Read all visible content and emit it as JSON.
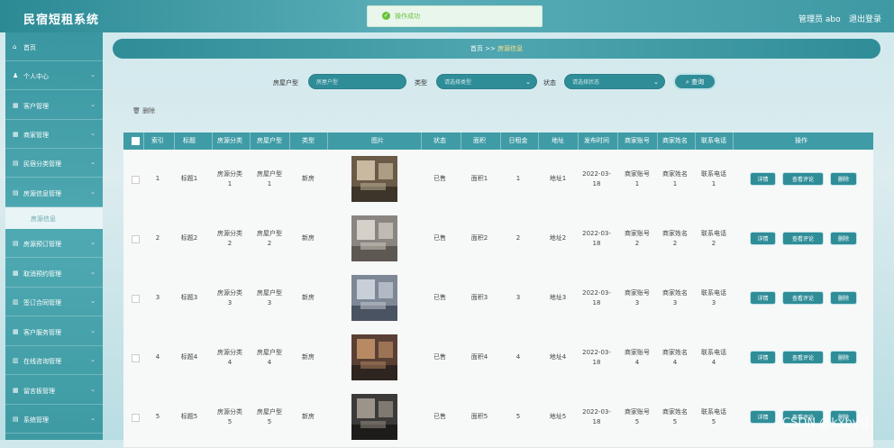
{
  "header": {
    "brand": "民宿短租系统",
    "toast": "操作成功",
    "user": "管理员 abo",
    "logout": "退出登录"
  },
  "sidebar": {
    "items": [
      {
        "icon": "⌂",
        "label": "首页"
      },
      {
        "icon": "♟",
        "label": "个人中心"
      },
      {
        "icon": "▦",
        "label": "客户管理"
      },
      {
        "icon": "▦",
        "label": "商家管理"
      },
      {
        "icon": "▤",
        "label": "民宿分类管理"
      },
      {
        "icon": "▤",
        "label": "房源信息管理"
      },
      {
        "icon": "▤",
        "label": "房源预订管理"
      },
      {
        "icon": "▦",
        "label": "取消预约管理"
      },
      {
        "icon": "▥",
        "label": "签订合同管理"
      },
      {
        "icon": "▦",
        "label": "客户服务管理"
      },
      {
        "icon": "▥",
        "label": "在线咨询管理"
      },
      {
        "icon": "▦",
        "label": "留言板管理"
      },
      {
        "icon": "▤",
        "label": "系统管理"
      }
    ],
    "sub_item": "房源信息"
  },
  "breadcrumb": {
    "home": "首页",
    "sep": ">>",
    "current": "房源信息"
  },
  "search": {
    "type_label": "房屋户型",
    "type_placeholder": "房屋户型",
    "kind_label": "类型",
    "kind_placeholder": "请选择类型",
    "status_label": "状态",
    "status_placeholder": "请选择状态",
    "button": "查询"
  },
  "delete_label": "删除",
  "table": {
    "headers": [
      "索引",
      "标题",
      "房源分类",
      "房屋户型",
      "类型",
      "图片",
      "状态",
      "面积",
      "日租金",
      "地址",
      "发布时间",
      "商家账号",
      "商家姓名",
      "联系电话",
      "操作"
    ],
    "rows": [
      {
        "idx": "1",
        "title": "标题1",
        "cat": [
          "房源分类",
          "1"
        ],
        "layout": [
          "房屋户型",
          "1"
        ],
        "kind": "新房",
        "status": "已售",
        "area": "面积1",
        "rent": "1",
        "addr": "地址1",
        "date": [
          "2022-03-",
          "18"
        ],
        "acct": [
          "商家账号",
          "1"
        ],
        "name": [
          "商家姓名",
          "1"
        ],
        "phone": [
          "联系电话",
          "1"
        ]
      },
      {
        "idx": "2",
        "title": "标题2",
        "cat": [
          "房源分类",
          "2"
        ],
        "layout": [
          "房屋户型",
          "2"
        ],
        "kind": "新房",
        "status": "已售",
        "area": "面积2",
        "rent": "2",
        "addr": "地址2",
        "date": [
          "2022-03-",
          "18"
        ],
        "acct": [
          "商家账号",
          "2"
        ],
        "name": [
          "商家姓名",
          "2"
        ],
        "phone": [
          "联系电话",
          "2"
        ]
      },
      {
        "idx": "3",
        "title": "标题3",
        "cat": [
          "房源分类",
          "3"
        ],
        "layout": [
          "房屋户型",
          "3"
        ],
        "kind": "新房",
        "status": "已售",
        "area": "面积3",
        "rent": "3",
        "addr": "地址3",
        "date": [
          "2022-03-",
          "18"
        ],
        "acct": [
          "商家账号",
          "3"
        ],
        "name": [
          "商家姓名",
          "3"
        ],
        "phone": [
          "联系电话",
          "3"
        ]
      },
      {
        "idx": "4",
        "title": "标题4",
        "cat": [
          "房源分类",
          "4"
        ],
        "layout": [
          "房屋户型",
          "4"
        ],
        "kind": "新房",
        "status": "已售",
        "area": "面积4",
        "rent": "4",
        "addr": "地址4",
        "date": [
          "2022-03-",
          "18"
        ],
        "acct": [
          "商家账号",
          "4"
        ],
        "name": [
          "商家姓名",
          "4"
        ],
        "phone": [
          "联系电话",
          "4"
        ]
      },
      {
        "idx": "5",
        "title": "标题5",
        "cat": [
          "房源分类",
          "5"
        ],
        "layout": [
          "房屋户型",
          "5"
        ],
        "kind": "新房",
        "status": "已售",
        "area": "面积5",
        "rent": "5",
        "addr": "地址5",
        "date": [
          "2022-03-",
          "18"
        ],
        "acct": [
          "商家账号",
          "5"
        ],
        "name": [
          "商家姓名",
          "5"
        ],
        "phone": [
          "联系电话",
          "5"
        ]
      }
    ],
    "actions": [
      "详情",
      "查看评论",
      "删除"
    ]
  },
  "watermark": "CSDN @kxbysj"
}
